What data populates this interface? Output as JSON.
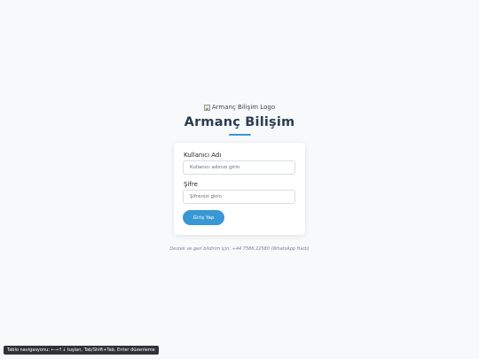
{
  "logo": {
    "alt": "Armanç Bilişim Logo"
  },
  "brand": {
    "title": "Armanç Bilişim",
    "accent_color": "#3a97d6"
  },
  "login_form": {
    "username_label": "Kullanıcı Adı",
    "username_placeholder": "Kullanıcı adınızı girin",
    "username_value": "",
    "password_label": "Şifre",
    "password_placeholder": "Şifrenizi girin",
    "password_value": "",
    "submit_label": "Giriş Yap"
  },
  "support": {
    "text": "Destek ve geri bildirim için: +44 7586 22580 (WhatsApp Hattı)"
  },
  "nav_hint": {
    "text": "Tablo navigasyonu: ←→↑↓ tuşları, Tab/Shift+Tab, Enter düzenleme"
  }
}
